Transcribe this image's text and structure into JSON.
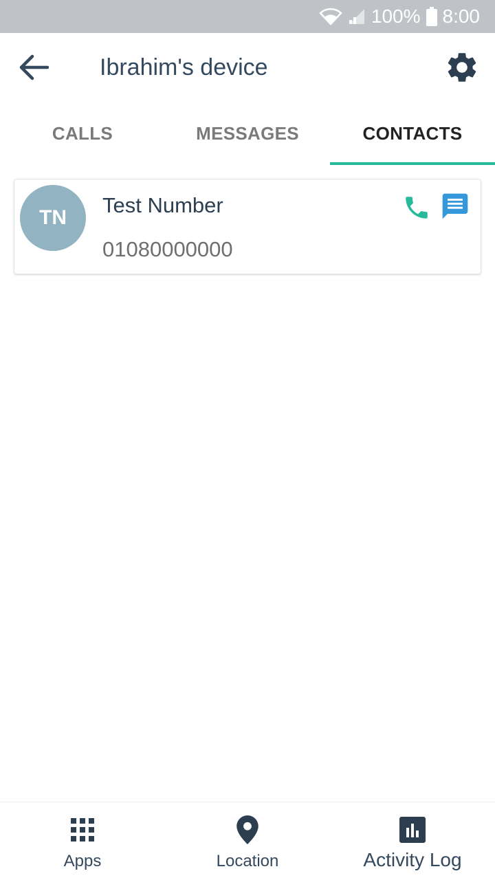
{
  "status_bar": {
    "battery": "100%",
    "time": "8:00"
  },
  "app_bar": {
    "title": "Ibrahim's device",
    "back_icon": "arrow-left-icon",
    "settings_icon": "gear-icon"
  },
  "tabs": [
    {
      "label": "CALLS",
      "active": false
    },
    {
      "label": "MESSAGES",
      "active": false
    },
    {
      "label": "CONTACTS",
      "active": true
    }
  ],
  "contacts": [
    {
      "initials": "TN",
      "name": "Test Number",
      "number": "01080000000"
    }
  ],
  "bottom_nav": [
    {
      "label": "Apps",
      "icon": "grid-icon"
    },
    {
      "label": "Location",
      "icon": "location-pin-icon"
    },
    {
      "label": "Activity Log",
      "icon": "bar-chart-icon"
    }
  ],
  "colors": {
    "accent": "#26b99a",
    "primary_text": "#34495e",
    "avatar_bg": "#92b3c1",
    "message_icon": "#3498db",
    "status_bar_bg": "#bfc3c7"
  }
}
